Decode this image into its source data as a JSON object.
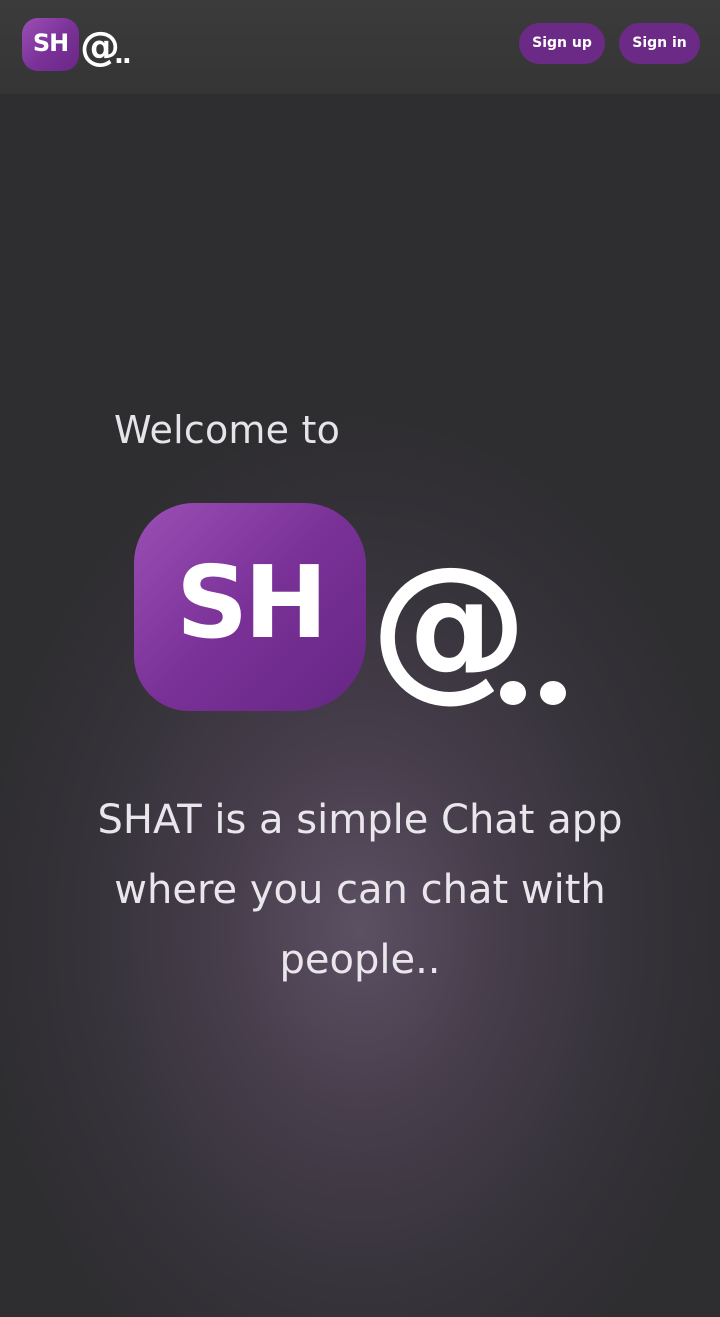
{
  "header": {
    "logo": {
      "tile_text": "SH",
      "at_text": "@",
      "dots_text": ".."
    },
    "buttons": {
      "sign_up": "Sign up",
      "sign_in": "Sign in"
    }
  },
  "hero": {
    "welcome": "Welcome to",
    "logo": {
      "tile_text": "SH",
      "at_text": "@"
    },
    "tagline": "SHAT is a simple Chat app where you can chat with people.."
  },
  "colors": {
    "brand_purple": "#7a3197",
    "button_purple": "#6b2a85",
    "header_bg": "#383839",
    "page_bg": "#2e2d30",
    "text_light": "#e6e4e9"
  }
}
